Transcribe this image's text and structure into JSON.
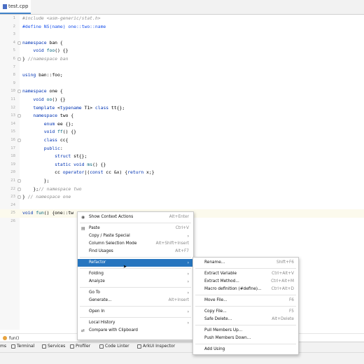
{
  "tab": {
    "label": "test.cpp"
  },
  "lines": [
    {
      "n": "1",
      "html": "<span class=\"cm\">#include &lt;asm-generic/stat.h&gt;</span>"
    },
    {
      "n": "2",
      "html": "<span class=\"mc\">#define NS(name) one::two::name</span>"
    },
    {
      "n": "3",
      "html": ""
    },
    {
      "n": "4",
      "html": "<span class=\"kw\">namespace</span> ban {"
    },
    {
      "n": "5",
      "html": "    <span class=\"kw\">void</span> <span class=\"fn\">foo</span>() {}"
    },
    {
      "n": "6",
      "html": "} <span class=\"cm\">//namespace ban</span>"
    },
    {
      "n": "7",
      "html": ""
    },
    {
      "n": "8",
      "html": "<span class=\"kw\">using</span> ban::foo;"
    },
    {
      "n": "9",
      "html": ""
    },
    {
      "n": "10",
      "html": "<span class=\"kw\">namespace</span> one {"
    },
    {
      "n": "11",
      "html": "    <span class=\"kw\">void</span> <span class=\"fn\">oo</span>() {}"
    },
    {
      "n": "12",
      "html": "    <span class=\"kw\">template</span> &lt;<span class=\"kw\">typename</span> T1&gt; <span class=\"kw\">class</span> tt{};"
    },
    {
      "n": "13",
      "html": "    <span class=\"kw\">namespace</span> two {"
    },
    {
      "n": "14",
      "html": "        <span class=\"kw\">enum</span> ee {};"
    },
    {
      "n": "15",
      "html": "        <span class=\"kw\">void</span> <span class=\"fn\">ff</span>() {}"
    },
    {
      "n": "16",
      "html": "        <span class=\"kw\">class</span> cc{"
    },
    {
      "n": "17",
      "html": "        <span class=\"kw\">public</span>:"
    },
    {
      "n": "18",
      "html": "            <span class=\"kw\">struct</span> st{};"
    },
    {
      "n": "19",
      "html": "            <span class=\"kw\">static</span> <span class=\"kw\">void</span> <span class=\"fn\">ms</span>() {}"
    },
    {
      "n": "20",
      "html": "            cc <span class=\"kw\">operator</span>|(<span class=\"kw\">const</span> cc &amp;x) {<span class=\"kw\">return</span> x;}"
    },
    {
      "n": "21",
      "html": "        };"
    },
    {
      "n": "22",
      "html": "    };<span class=\"cm\">// namespace two</span>"
    },
    {
      "n": "23",
      "html": "} <span class=\"cm\">// namespace one</span>"
    },
    {
      "n": "24",
      "html": ""
    },
    {
      "n": "25",
      "html": "<span class=\"kw\">void</span> <span class=\"fn\">fun</span>() {one::tw"
    },
    {
      "n": "26",
      "html": ""
    }
  ],
  "breadcrumb": {
    "label": "fun()"
  },
  "toolwindows": [
    {
      "label": "ms"
    },
    {
      "label": "Terminal"
    },
    {
      "label": "Services"
    },
    {
      "label": "Profiler"
    },
    {
      "label": "Code Linter"
    },
    {
      "label": "ArkUI Inspector"
    }
  ],
  "context_menu": [
    {
      "label": "Show Context Actions",
      "shortcut": "Alt+Enter",
      "icon": "bulb-icon"
    },
    {
      "sep": true
    },
    {
      "label": "Paste",
      "shortcut": "Ctrl+V",
      "icon": "paste-icon"
    },
    {
      "label": "Copy / Paste Special",
      "submenu": true
    },
    {
      "label": "Column Selection Mode",
      "shortcut": "Alt+Shift+Insert"
    },
    {
      "label": "Find Usages",
      "shortcut": "Alt+F7"
    },
    {
      "sep": true
    },
    {
      "label": "Refactor",
      "submenu": true,
      "selected": true
    },
    {
      "sep": true
    },
    {
      "label": "Folding",
      "submenu": true
    },
    {
      "label": "Analyze",
      "submenu": true
    },
    {
      "sep": true
    },
    {
      "label": "Go To",
      "submenu": true
    },
    {
      "label": "Generate...",
      "shortcut": "Alt+Insert"
    },
    {
      "sep": true
    },
    {
      "label": "Open In",
      "submenu": true
    },
    {
      "sep": true
    },
    {
      "label": "Local History",
      "submenu": true
    },
    {
      "label": "Compare with Clipboard",
      "icon": "compare-icon"
    }
  ],
  "refactor_menu": [
    {
      "label": "Rename...",
      "shortcut": "Shift+F6"
    },
    {
      "sep": true
    },
    {
      "label": "Extract Variable",
      "shortcut": "Ctrl+Alt+V"
    },
    {
      "label": "Extract Method...",
      "shortcut": "Ctrl+Alt+M"
    },
    {
      "label": "Macro definition (#define)...",
      "shortcut": "Ctrl+Alt+D"
    },
    {
      "sep": true
    },
    {
      "label": "Move File...",
      "shortcut": "F6"
    },
    {
      "sep": true
    },
    {
      "label": "Copy File...",
      "shortcut": "F5"
    },
    {
      "label": "Safe Delete...",
      "shortcut": "Alt+Delete"
    },
    {
      "sep": true
    },
    {
      "label": "Pull Members Up..."
    },
    {
      "label": "Push Members Down..."
    },
    {
      "sep": true
    },
    {
      "label": "Add Using"
    }
  ]
}
